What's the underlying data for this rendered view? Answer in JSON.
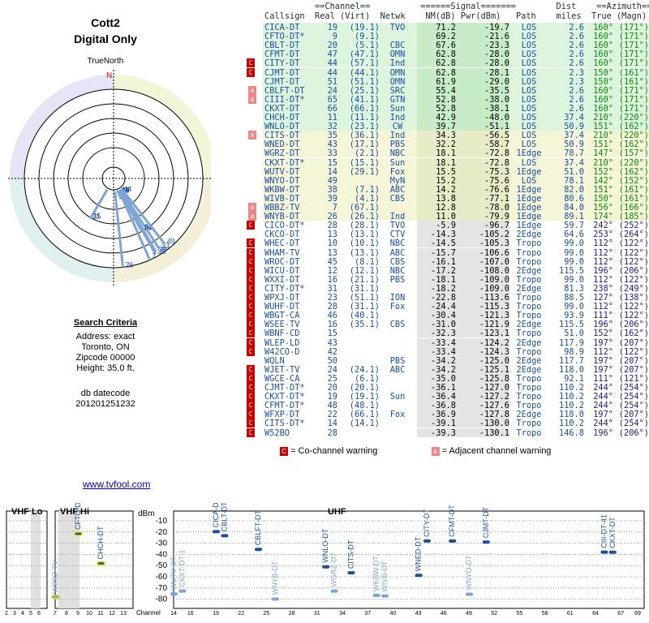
{
  "title": {
    "name": "Cott2",
    "subtitle": "Digital Only"
  },
  "polar": {
    "north_label": "TrueNorth",
    "n": "N"
  },
  "search": {
    "heading": "Search Criteria",
    "address": "Address: exact",
    "city": "Toronto, ON",
    "zip": "Zipcode 00000",
    "height": "Height: 35.0 ft.",
    "db": "db datecode",
    "dbcode": "201201251232"
  },
  "link": "www.tvfool.com",
  "table": {
    "group_headers": "          ==Channel==          ======Signal=======        Dist    ==Azimuth==",
    "col_headers": "Callsign  Real (Virt)  Netwk    NM(dB) Pwr(dBm)   Path    miles  True (Magn)",
    "rows": [
      {
        "mark": "",
        "cs": "CICA-DT",
        "ch": "19",
        "v": "(19.1)",
        "net": "TVO",
        "nm": "71.2",
        "pwr": "-19.7",
        "path": "LOS",
        "dist": "2.6",
        "az": "160°",
        "mag": "(171°)",
        "band": "g"
      },
      {
        "mark": "",
        "cs": "CFTO-DT*",
        "ch": "9",
        "v": "(9.1)",
        "net": "",
        "nm": "69.2",
        "pwr": "-21.6",
        "path": "LOS",
        "dist": "2.6",
        "az": "160°",
        "mag": "(171°)",
        "band": "g"
      },
      {
        "mark": "",
        "cs": "CBLT-DT",
        "ch": "20",
        "v": "(5.1)",
        "net": "CBC",
        "nm": "67.6",
        "pwr": "-23.3",
        "path": "LOS",
        "dist": "2.6",
        "az": "160°",
        "mag": "(171°)",
        "band": "g"
      },
      {
        "mark": "",
        "cs": "CFMT-DT",
        "ch": "47",
        "v": "(47.1)",
        "net": "OMN",
        "nm": "62.8",
        "pwr": "-28.0",
        "path": "LOS",
        "dist": "2.6",
        "az": "160°",
        "mag": "(171°)",
        "band": "g"
      },
      {
        "mark": "C",
        "cs": "CITY-DT",
        "ch": "44",
        "v": "(57.1)",
        "net": "Ind",
        "nm": "62.8",
        "pwr": "-28.0",
        "path": "LOS",
        "dist": "2.6",
        "az": "160°",
        "mag": "(171°)",
        "band": "g"
      },
      {
        "mark": "C",
        "cs": "CJMT-DT",
        "ch": "44",
        "v": "(44.1)",
        "net": "OMN",
        "nm": "62.8",
        "pwr": "-28.1",
        "path": "LOS",
        "dist": "2.3",
        "az": "150°",
        "mag": "(161°)",
        "band": "g"
      },
      {
        "mark": "",
        "cs": "CJMT-DT",
        "ch": "51",
        "v": "(51.1)",
        "net": "OMN",
        "nm": "61.9",
        "pwr": "-29.0",
        "path": "LOS",
        "dist": "2.3",
        "az": "150°",
        "mag": "(161°)",
        "band": "g"
      },
      {
        "mark": "a",
        "cs": "CBLFT-DT",
        "ch": "24",
        "v": "(25.1)",
        "net": "SRC",
        "nm": "55.4",
        "pwr": "-35.5",
        "path": "LOS",
        "dist": "2.6",
        "az": "160°",
        "mag": "(171°)",
        "band": "g"
      },
      {
        "mark": "a",
        "cs": "CIII-DT*",
        "ch": "65",
        "v": "(41.1)",
        "net": "GTN",
        "nm": "52.8",
        "pwr": "-38.0",
        "path": "LOS",
        "dist": "2.6",
        "az": "160°",
        "mag": "(171°)",
        "band": "g"
      },
      {
        "mark": "",
        "cs": "CKXT-DT",
        "ch": "66",
        "v": "(66.1)",
        "net": "Sun",
        "nm": "52.8",
        "pwr": "-38.1",
        "path": "LOS",
        "dist": "2.6",
        "az": "160°",
        "mag": "(171°)",
        "band": "g"
      },
      {
        "mark": "",
        "cs": "CHCH-DT",
        "ch": "11",
        "v": "(11.1)",
        "net": "Ind",
        "nm": "42.9",
        "pwr": "-48.0",
        "path": "LOS",
        "dist": "37.4",
        "az": "210°",
        "mag": "(220°)",
        "band": "g"
      },
      {
        "mark": "",
        "cs": "WNLO-DT",
        "ch": "32",
        "v": "(23.1)",
        "net": "CW",
        "nm": "39.7",
        "pwr": "-51.1",
        "path": "LOS",
        "dist": "50.9",
        "az": "151°",
        "mag": "(162°)",
        "band": "g"
      },
      {
        "mark": "a",
        "cs": "CITS-DT",
        "ch": "35",
        "v": "(36.1)",
        "net": "Ind",
        "nm": "34.3",
        "pwr": "-56.5",
        "path": "LOS",
        "dist": "37.4",
        "az": "210°",
        "mag": "(220°)",
        "band": "y"
      },
      {
        "mark": "",
        "cs": "WNED-DT",
        "ch": "43",
        "v": "(17.1)",
        "net": "PBS",
        "nm": "32.2",
        "pwr": "-58.7",
        "path": "LOS",
        "dist": "50.9",
        "az": "151°",
        "mag": "(162°)",
        "band": "y"
      },
      {
        "mark": "",
        "cs": "WGRZ-DT",
        "ch": "33",
        "v": "(2.1)",
        "net": "NBC",
        "nm": "18.1",
        "pwr": "-72.8",
        "path": "1Edge",
        "dist": "78.7",
        "az": "147°",
        "mag": "(157°)",
        "band": "y"
      },
      {
        "mark": "",
        "cs": "CKXT-DT*",
        "ch": "15",
        "v": "(15.1)",
        "net": "Sun",
        "nm": "18.1",
        "pwr": "-72.8",
        "path": "LOS",
        "dist": "37.4",
        "az": "210°",
        "mag": "(220°)",
        "band": "y"
      },
      {
        "mark": "",
        "cs": "WUTV-DT",
        "ch": "14",
        "v": "(29.1)",
        "net": "Fox",
        "nm": "15.5",
        "pwr": "-75.3",
        "path": "1Edge",
        "dist": "51.0",
        "az": "152°",
        "mag": "(162°)",
        "band": "y"
      },
      {
        "mark": "",
        "cs": "WNYO-DT",
        "ch": "49",
        "v": "",
        "net": "MyN",
        "nm": "15.2",
        "pwr": "-75.6",
        "path": "LOS",
        "dist": "78.1",
        "az": "142°",
        "mag": "(152°)",
        "band": "y"
      },
      {
        "mark": "",
        "cs": "WKBW-DT",
        "ch": "38",
        "v": "(7.1)",
        "net": "ABC",
        "nm": "14.2",
        "pwr": "-76.6",
        "path": "1Edge",
        "dist": "82.0",
        "az": "151°",
        "mag": "(161°)",
        "band": "y"
      },
      {
        "mark": "",
        "cs": "WIVB-DT",
        "ch": "39",
        "v": "(4.1)",
        "net": "CBS",
        "nm": "13.8",
        "pwr": "-77.1",
        "path": "1Edge",
        "dist": "80.6",
        "az": "150°",
        "mag": "(161°)",
        "band": "y"
      },
      {
        "mark": "a",
        "cs": "WBBZ-TV",
        "ch": "7",
        "v": "(67.1)",
        "net": "",
        "nm": "12.8",
        "pwr": "-78.0",
        "path": "1Edge",
        "dist": "84.0",
        "az": "156°",
        "mag": "(166°)",
        "band": "y"
      },
      {
        "mark": "a",
        "cs": "WNYB-DT",
        "ch": "26",
        "v": "(26.1)",
        "net": "Ind",
        "nm": "11.0",
        "pwr": "-79.9",
        "path": "1Edge",
        "dist": "89.1",
        "az": "174°",
        "mag": "(185°)",
        "band": "y"
      },
      {
        "mark": "C",
        "cs": "CICO-DT*",
        "ch": "28",
        "v": "(28.1)",
        "net": "TVO",
        "nm": "-5.9",
        "pwr": "-96.7",
        "path": "1Edge",
        "dist": "59.7",
        "az": "242°",
        "mag": "(252°)",
        "band": "r"
      },
      {
        "mark": "",
        "cs": "CKCO-DT",
        "ch": "13",
        "v": "(13.1)",
        "net": "CTV",
        "nm": "-14.3",
        "pwr": "-105.2",
        "path": "2Edge",
        "dist": "64.6",
        "az": "253°",
        "mag": "(264°)",
        "band": "r"
      },
      {
        "mark": "C",
        "cs": "WHEC-DT",
        "ch": "10",
        "v": "(10.1)",
        "net": "NBC",
        "nm": "-14.5",
        "pwr": "-105.3",
        "path": "Tropo",
        "dist": "99.0",
        "az": "112°",
        "mag": "(122°)",
        "band": "r"
      },
      {
        "mark": "C",
        "cs": "WHAM-TV",
        "ch": "13",
        "v": "(13.1)",
        "net": "ABC",
        "nm": "-15.7",
        "pwr": "-106.6",
        "path": "Tropo",
        "dist": "99.0",
        "az": "112°",
        "mag": "(122°)",
        "band": "r"
      },
      {
        "mark": "C",
        "cs": "WROC-DT",
        "ch": "45",
        "v": "(8.1)",
        "net": "CBS",
        "nm": "-16.1",
        "pwr": "-107.0",
        "path": "Tropo",
        "dist": "99.0",
        "az": "112°",
        "mag": "(122°)",
        "band": "r"
      },
      {
        "mark": "C",
        "cs": "WICU-DT",
        "ch": "12",
        "v": "(12.1)",
        "net": "NBC",
        "nm": "-17.2",
        "pwr": "-108.0",
        "path": "2Edge",
        "dist": "115.5",
        "az": "196°",
        "mag": "(206°)",
        "band": "r"
      },
      {
        "mark": "C",
        "cs": "WXXI-DT",
        "ch": "16",
        "v": "(21.1)",
        "net": "PBS",
        "nm": "-18.1",
        "pwr": "-109.0",
        "path": "Tropo",
        "dist": "99.0",
        "az": "112°",
        "mag": "(122°)",
        "band": "r"
      },
      {
        "mark": "C",
        "cs": "CITY-DT*",
        "ch": "31",
        "v": "(31.1)",
        "net": "",
        "nm": "-18.2",
        "pwr": "-109.0",
        "path": "2Edge",
        "dist": "81.3",
        "az": "238°",
        "mag": "(249°)",
        "band": "r"
      },
      {
        "mark": "C",
        "cs": "WPXJ-DT",
        "ch": "23",
        "v": "(51.1)",
        "net": "ION",
        "nm": "-22.8",
        "pwr": "-113.6",
        "path": "Tropo",
        "dist": "88.5",
        "az": "127°",
        "mag": "(138°)",
        "band": "r"
      },
      {
        "mark": "C",
        "cs": "WUHF-DT",
        "ch": "28",
        "v": "(31.1)",
        "net": "Fox",
        "nm": "-24.4",
        "pwr": "-115.3",
        "path": "Tropo",
        "dist": "99.0",
        "az": "112°",
        "mag": "(122°)",
        "band": "r"
      },
      {
        "mark": "C",
        "cs": "WBGT-CA",
        "ch": "46",
        "v": "(40.1)",
        "net": "",
        "nm": "-30.4",
        "pwr": "-121.3",
        "path": "Tropo",
        "dist": "93.9",
        "az": "111°",
        "mag": "(122°)",
        "band": "r"
      },
      {
        "mark": "C",
        "cs": "WSEE-TV",
        "ch": "16",
        "v": "(35.1)",
        "net": "CBS",
        "nm": "-31.0",
        "pwr": "-121.9",
        "path": "2Edge",
        "dist": "115.5",
        "az": "196°",
        "mag": "(206°)",
        "band": "r"
      },
      {
        "mark": "C",
        "cs": "WBNF-CD",
        "ch": "15",
        "v": "",
        "net": "",
        "nm": "-32.3",
        "pwr": "-123.1",
        "path": "Tropo",
        "dist": "51.0",
        "az": "152°",
        "mag": "(162°)",
        "band": "r"
      },
      {
        "mark": "C",
        "cs": "WLEP-LD",
        "ch": "43",
        "v": "",
        "net": "",
        "nm": "-33.4",
        "pwr": "-124.2",
        "path": "2Edge",
        "dist": "117.9",
        "az": "197°",
        "mag": "(207°)",
        "band": "r"
      },
      {
        "mark": "C",
        "cs": "W42CO-D",
        "ch": "42",
        "v": "",
        "net": "",
        "nm": "-33.4",
        "pwr": "-124.3",
        "path": "Tropo",
        "dist": "98.9",
        "az": "112°",
        "mag": "(122°)",
        "band": "r"
      },
      {
        "mark": "",
        "cs": "WQLN",
        "ch": "50",
        "v": "",
        "net": "PBS",
        "nm": "-34.2",
        "pwr": "-125.0",
        "path": "2Edge",
        "dist": "117.7",
        "az": "197°",
        "mag": "(207°)",
        "band": "r"
      },
      {
        "mark": "C",
        "cs": "WJET-TV",
        "ch": "24",
        "v": "(24.1)",
        "net": "ABC",
        "nm": "-34.2",
        "pwr": "-125.1",
        "path": "2Edge",
        "dist": "118.0",
        "az": "197°",
        "mag": "(207°)",
        "band": "r"
      },
      {
        "mark": "C",
        "cs": "WGCE-CA",
        "ch": "25",
        "v": "(6.1)",
        "net": "",
        "nm": "-35.0",
        "pwr": "-125.8",
        "path": "Tropo",
        "dist": "92.1",
        "az": "111°",
        "mag": "(121°)",
        "band": "r"
      },
      {
        "mark": "C",
        "cs": "CJMT-DT*",
        "ch": "20",
        "v": "(20.1)",
        "net": "",
        "nm": "-36.1",
        "pwr": "-127.0",
        "path": "Tropo",
        "dist": "110.2",
        "az": "244°",
        "mag": "(254°)",
        "band": "r"
      },
      {
        "mark": "C",
        "cs": "CKXT-DT*",
        "ch": "19",
        "v": "(19.1)",
        "net": "Sun",
        "nm": "-36.4",
        "pwr": "-127.2",
        "path": "Tropo",
        "dist": "110.2",
        "az": "244°",
        "mag": "(254°)",
        "band": "r"
      },
      {
        "mark": "C",
        "cs": "CFMT-DT*",
        "ch": "48",
        "v": "(48.1)",
        "net": "",
        "nm": "-36.8",
        "pwr": "-127.6",
        "path": "Tropo",
        "dist": "110.2",
        "az": "244°",
        "mag": "(254°)",
        "band": "r"
      },
      {
        "mark": "C",
        "cs": "WFXP-DT",
        "ch": "22",
        "v": "(66.1)",
        "net": "Fox",
        "nm": "-36.9",
        "pwr": "-127.8",
        "path": "2Edge",
        "dist": "118.0",
        "az": "197°",
        "mag": "(207°)",
        "band": "r"
      },
      {
        "mark": "C",
        "cs": "CITS-DT*",
        "ch": "14",
        "v": "(14.1)",
        "net": "",
        "nm": "-39.1",
        "pwr": "-130.0",
        "path": "Tropo",
        "dist": "110.2",
        "az": "244°",
        "mag": "(254°)",
        "band": "r"
      },
      {
        "mark": "C",
        "cs": "W52BO",
        "ch": "28",
        "v": "",
        "net": "",
        "nm": "-39.3",
        "pwr": "-130.1",
        "path": "Tropo",
        "dist": "146.8",
        "az": "196°",
        "mag": "(206°)",
        "band": "r"
      }
    ]
  },
  "legend": {
    "co": "= Co-channel warning",
    "adj": "= Adjacent channel warning",
    "co_mark": "C",
    "adj_mark": "a"
  },
  "spectrum": {
    "vhf_lo": "VHF Lo",
    "vhf_hi": "VHF Hi",
    "uhf": "UHF",
    "dbm": "dBm",
    "channel": "Channel",
    "y_ticks": [
      "-10",
      "-20",
      "-30",
      "-40",
      "-50",
      "-60",
      "-70",
      "-80"
    ],
    "lo_ticks": [
      "2",
      "3",
      "4",
      "5",
      "6"
    ],
    "hi_ticks": [
      "7",
      "8",
      "9",
      "10",
      "11",
      "12",
      "13"
    ],
    "uhf_ticks": [
      "14",
      "16",
      "19",
      "22",
      "25",
      "28",
      "31",
      "34",
      "37",
      "40",
      "43",
      "46",
      "49",
      "52",
      "55",
      "58",
      "61",
      "64",
      "67",
      "69"
    ]
  },
  "chart_data": {
    "type": "scatter",
    "ylabel": "dBm",
    "xlabel": "Channel",
    "ylim": [
      -90,
      0
    ],
    "series": [
      {
        "points": [
          {
            "x": 19,
            "y": -19.7,
            "label": "CICA-DT"
          },
          {
            "x": 9,
            "y": -21.6,
            "label": "CFTO-DT"
          },
          {
            "x": 20,
            "y": -23.3,
            "label": "CBLT-DT"
          },
          {
            "x": 47,
            "y": -28.0,
            "label": "CFMT-DT"
          },
          {
            "x": 44,
            "y": -28.0,
            "label": "CITY-DT"
          },
          {
            "x": 51,
            "y": -29.0,
            "label": "CJMT-DT"
          },
          {
            "x": 24,
            "y": -35.5,
            "label": "CBLFT-DT"
          },
          {
            "x": 65,
            "y": -38.0,
            "label": "CIII-DT-41"
          },
          {
            "x": 66,
            "y": -38.1,
            "label": "CKXT-DT"
          },
          {
            "x": 11,
            "y": -48.0,
            "label": "CHCH-DT"
          },
          {
            "x": 32,
            "y": -51.1,
            "label": "WNLO-DT"
          },
          {
            "x": 35,
            "y": -56.5,
            "label": "CITS-DT"
          },
          {
            "x": 43,
            "y": -58.7,
            "label": "WNED-DT"
          },
          {
            "x": 33,
            "y": -72.8,
            "label": "WGRZ-DT"
          },
          {
            "x": 15,
            "y": -72.8,
            "label": "CKXT-DT-1"
          },
          {
            "x": 14,
            "y": -75.3,
            "label": "WUTV-DT"
          },
          {
            "x": 49,
            "y": -75.6,
            "label": "WNYO-DT"
          },
          {
            "x": 38,
            "y": -76.6,
            "label": "WKBW-DT"
          },
          {
            "x": 39,
            "y": -77.1,
            "label": "WIVB-DT"
          },
          {
            "x": 7,
            "y": -78.0,
            "label": "WBBZ-TV"
          },
          {
            "x": 26,
            "y": -79.9,
            "label": "WNYB-DT"
          }
        ]
      }
    ]
  }
}
